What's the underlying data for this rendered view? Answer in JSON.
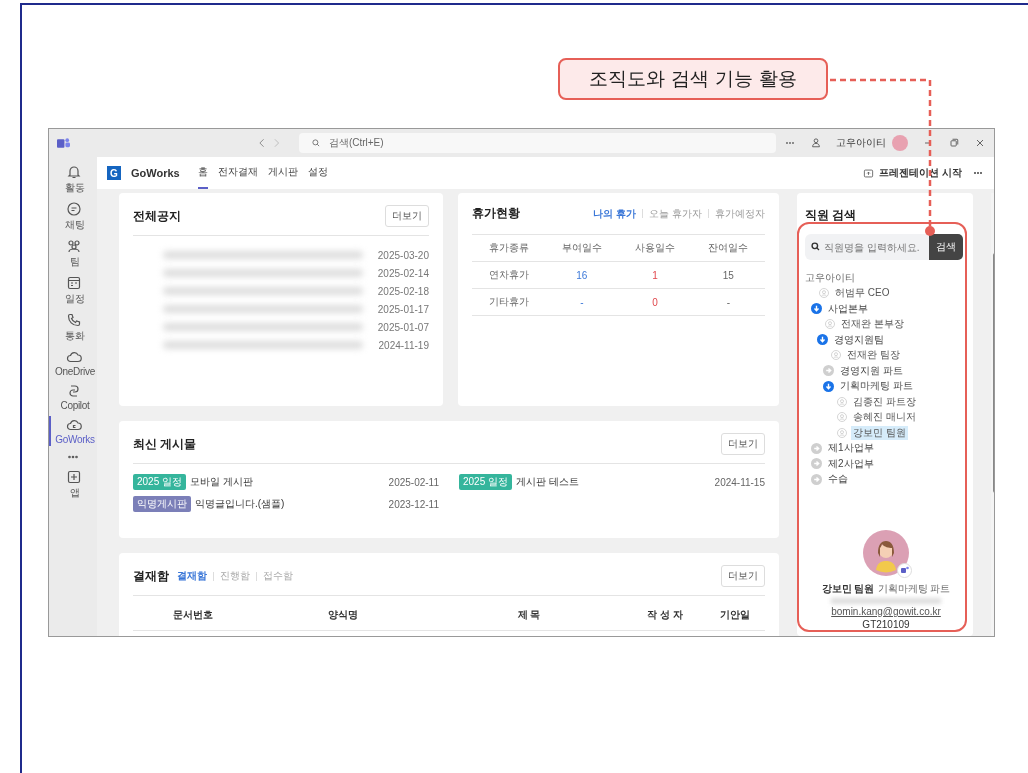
{
  "callout": {
    "text": "조직도와 검색 기능 활용"
  },
  "titlebar": {
    "search_placeholder": "검색(Ctrl+E)",
    "user": "고우아이티"
  },
  "rail": [
    {
      "label": "활동",
      "selected": false
    },
    {
      "label": "채팅",
      "selected": false
    },
    {
      "label": "팀",
      "selected": false
    },
    {
      "label": "일정",
      "selected": false
    },
    {
      "label": "통화",
      "selected": false
    },
    {
      "label": "OneDrive",
      "selected": false
    },
    {
      "label": "Copilot",
      "selected": false
    },
    {
      "label": "GoWorks",
      "selected": true
    },
    {
      "label": "앱",
      "selected": false
    }
  ],
  "app": {
    "name": "GoWorks",
    "logo_letter": "G",
    "present": "프레젠테이션 시작",
    "tabs": [
      {
        "label": "홈",
        "selected": true
      },
      {
        "label": "전자결재",
        "selected": false
      },
      {
        "label": "게시판",
        "selected": false
      },
      {
        "label": "설정",
        "selected": false
      }
    ]
  },
  "notices": {
    "title": "전체공지",
    "more": "더보기",
    "dates": [
      "2025-03-20",
      "2025-02-14",
      "2025-02-18",
      "2025-01-17",
      "2025-01-07",
      "2024-11-19"
    ]
  },
  "leave": {
    "title": "휴가현황",
    "filters": [
      {
        "label": "나의 휴가",
        "selected": true
      },
      {
        "label": "오늘 휴가자",
        "selected": false
      },
      {
        "label": "휴가예정자",
        "selected": false
      }
    ],
    "columns": [
      "휴가종류",
      "부여일수",
      "사용일수",
      "잔여일수"
    ],
    "rows": [
      [
        "연차휴가",
        "16",
        "1",
        "15"
      ],
      [
        "기타휴가",
        "-",
        "0",
        "-"
      ]
    ]
  },
  "posts": {
    "title": "최신 게시물",
    "more": "더보기",
    "items": [
      {
        "tag": "2025 일정",
        "color": "#35b59c",
        "title": "모바일 게시판",
        "date": "2025-02-11"
      },
      {
        "tag": "2025 일정",
        "color": "#35b59c",
        "title": "게시판 테스트",
        "date": "2024-11-15"
      },
      {
        "tag": "익명게시판",
        "color": "#7b7fb8",
        "title": "익명글입니다.(샘플)",
        "date": "2023-12-11"
      }
    ]
  },
  "approval": {
    "title": "결재함",
    "more": "더보기",
    "tabs": [
      {
        "label": "결재함",
        "selected": true
      },
      {
        "label": "진행함",
        "selected": false
      },
      {
        "label": "접수함",
        "selected": false
      }
    ],
    "columns": [
      "문서번호",
      "양식명",
      "제 목",
      "작 성 자",
      "기안일"
    ]
  },
  "directory": {
    "title": "직원 검색",
    "placeholder": "직원명을 입력하세요.",
    "button": "검색",
    "tree": [
      {
        "label": "고우아이티",
        "kind": "root",
        "selected": false,
        "children": [
          {
            "label": "허범무 CEO",
            "kind": "person",
            "selected": false
          },
          {
            "label": "사업본부",
            "kind": "group",
            "expanded": true,
            "selected": false,
            "children": [
              {
                "label": "전재완 본부장",
                "kind": "person",
                "selected": false
              },
              {
                "label": "경영지원팀",
                "kind": "group",
                "expanded": true,
                "selected": false,
                "children": [
                  {
                    "label": "전재완 팀장",
                    "kind": "person",
                    "selected": false
                  },
                  {
                    "label": "경영지원 파트",
                    "kind": "group",
                    "expanded": false,
                    "selected": false
                  },
                  {
                    "label": "기획마케팅 파트",
                    "kind": "group",
                    "expanded": true,
                    "selected": false,
                    "children": [
                      {
                        "label": "김종진 파트장",
                        "kind": "person",
                        "selected": false
                      },
                      {
                        "label": "송혜진 매니저",
                        "kind": "person",
                        "selected": false
                      },
                      {
                        "label": "강보민 팀원",
                        "kind": "person",
                        "selected": true
                      }
                    ]
                  }
                ]
              }
            ]
          },
          {
            "label": "제1사업부",
            "kind": "group",
            "expanded": false,
            "selected": false
          },
          {
            "label": "제2사업부",
            "kind": "group",
            "expanded": false,
            "selected": false
          },
          {
            "label": "수습",
            "kind": "group",
            "expanded": false,
            "selected": false
          }
        ]
      }
    ],
    "profile": {
      "name": "강보민 팀원",
      "dept": "기획마케팅 파트",
      "email": "bomin.kang@gowit.co.kr",
      "id": "GT210109"
    }
  }
}
